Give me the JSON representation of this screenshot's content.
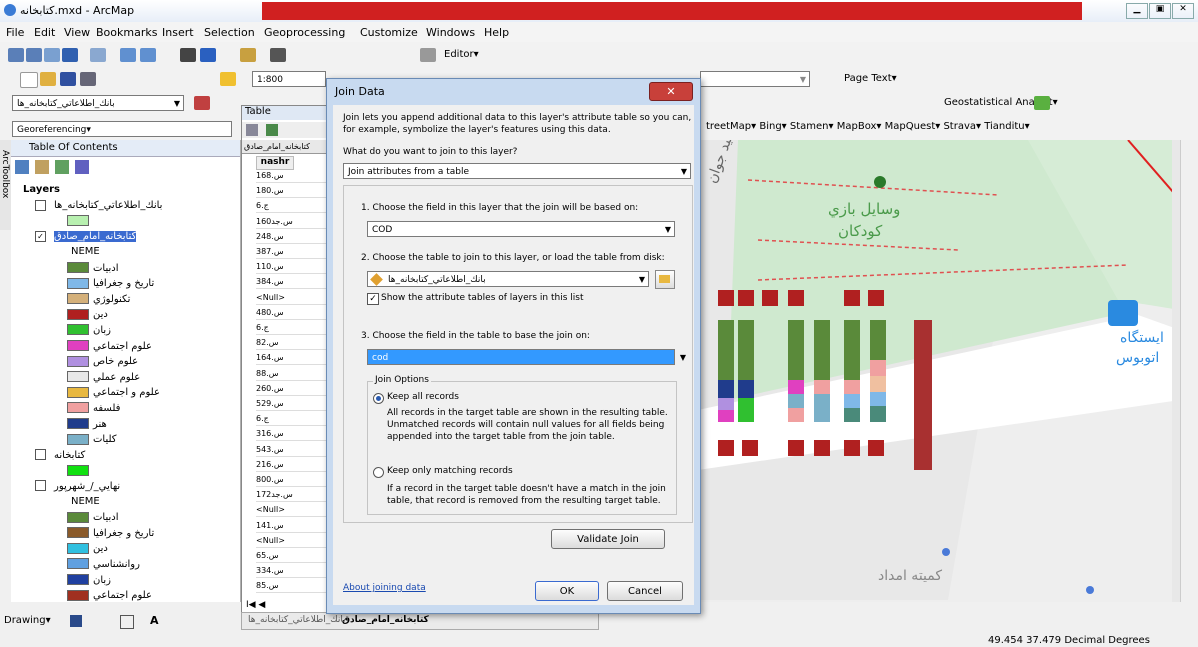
{
  "window": {
    "title": "کتابخانه.mxd - ArcMap"
  },
  "menu": [
    "File",
    "Edit",
    "View",
    "Bookmarks",
    "Insert",
    "Selection",
    "Geoprocessing",
    "Customize",
    "Windows",
    "Help"
  ],
  "toolbar": {
    "editor_label": "Editor▾",
    "scale_value": "1:800",
    "page_text": "Page Text▾",
    "layer_dropdown": "بانك_اطلاعاتي_كتابخانه_ها",
    "georeferencing": "Georeferencing▾",
    "geostatistical": "Geostatistical Analyst▾",
    "basemaps": [
      "treetMap▾",
      "Bing▾",
      "Stamen▾",
      "MapBox▾",
      "MapQuest▾",
      "Strava▾",
      "Tianditu▾"
    ],
    "drawing": "Drawing▾"
  },
  "toc": {
    "title": "Table Of Contents",
    "vertical_tab": "ArcToolbox",
    "rows": [
      {
        "label": "Layers",
        "kind": "group"
      },
      {
        "label": "بانك_اطلاعاتي_كتابخانه_ها",
        "kind": "layer"
      },
      {
        "label": "",
        "kind": "swatch",
        "color": "#b8f0b0"
      },
      {
        "label": "كتابخانه_امام_صادق",
        "kind": "layer-selected"
      },
      {
        "label": "NEME",
        "kind": "field"
      },
      {
        "label": "ادبيات",
        "kind": "swatch",
        "color": "#5a8a3a"
      },
      {
        "label": "تاريخ و جغرافيا",
        "kind": "swatch",
        "color": "#7fb8e8"
      },
      {
        "label": "تكنولوژي",
        "kind": "swatch",
        "color": "#d4b07a"
      },
      {
        "label": "دين",
        "kind": "swatch",
        "color": "#b02020"
      },
      {
        "label": "زبان",
        "kind": "swatch",
        "color": "#30c030"
      },
      {
        "label": "علوم اجتماعي",
        "kind": "swatch",
        "color": "#e040c0"
      },
      {
        "label": "علوم خاص",
        "kind": "swatch",
        "color": "#b090e0"
      },
      {
        "label": "علوم عملي",
        "kind": "swatch",
        "color": "#e8e8e8"
      },
      {
        "label": "علوم و اجتماعي",
        "kind": "swatch",
        "color": "#e8b840"
      },
      {
        "label": "فلسفه",
        "kind": "swatch",
        "color": "#f0a0a0"
      },
      {
        "label": "هنر",
        "kind": "swatch",
        "color": "#203c8c"
      },
      {
        "label": "كليات",
        "kind": "swatch",
        "color": "#7ab0c8"
      },
      {
        "label": "كتابخانه",
        "kind": "layer"
      },
      {
        "label": "",
        "kind": "swatch",
        "color": "#10e010"
      },
      {
        "label": "نهايي_/_شهرپور",
        "kind": "layer"
      },
      {
        "label": "NEME",
        "kind": "field"
      },
      {
        "label": "ادبيات",
        "kind": "swatch",
        "color": "#5a8a3a"
      },
      {
        "label": "تاريخ و جغرافيا",
        "kind": "swatch",
        "color": "#8a5a2a"
      },
      {
        "label": "دين",
        "kind": "swatch",
        "color": "#30c0e0"
      },
      {
        "label": "روانشناسي",
        "kind": "swatch",
        "color": "#60a0e0"
      },
      {
        "label": "زبان",
        "kind": "swatch",
        "color": "#2040a0"
      },
      {
        "label": "علوم اجتماعي",
        "kind": "swatch",
        "color": "#a03020"
      }
    ]
  },
  "table": {
    "title": "Table",
    "layer_tab": "كتابخانه_امام_صادق",
    "column": "nashr",
    "rows": [
      "168.س",
      "180.س",
      "6.ج",
      "160س.جد",
      "248.س",
      "387.س",
      "110.س",
      "384.س",
      "<Null>",
      "480.س",
      "6.ج",
      "82.س",
      "164.س",
      "88.س",
      "260.س",
      "529.س",
      "6.ج",
      "316.س",
      "543.س",
      "216.س",
      "800.س",
      "172س.جد",
      "<Null>",
      "141.س",
      "<Null>",
      "65.س",
      "334.س",
      "85.س"
    ],
    "nav": "I◀  ◀",
    "bottom_tabs": [
      "كتابخانه_امام_صادق",
      "بانك_اطلاعاتي_كتابخانه_ها"
    ]
  },
  "dialog": {
    "title": "Join Data",
    "intro": [
      "Join lets you append additional data to this layer's attribute table so you can,",
      "for example, symbolize the layer's features using this data."
    ],
    "question": "What do you want to join to this layer?",
    "join_type": "Join attributes from a table",
    "step1": "1.  Choose the field in this layer that the join will be based on:",
    "step1_value": "COD",
    "step2": "2.  Choose the table to join to this layer, or load the table from disk:",
    "step2_value": "بانك_اطلاعاتي_كتابخانه_ها",
    "show_checkbox": "Show the attribute tables of layers in this list",
    "step3": "3.  Choose the field in the table to base the join on:",
    "step3_value": "cod",
    "options_title": "Join Options",
    "keep_all": "Keep all records",
    "keep_all_desc": [
      "All records in the target table are shown in the resulting table.",
      "Unmatched records will contain null values for all fields being",
      "appended into the target table from the join table."
    ],
    "keep_matching": "Keep only matching records",
    "keep_matching_desc": [
      "If a record in the target table doesn't have a match in the join",
      "table, that record is removed from the resulting target table."
    ],
    "validate": "Validate Join",
    "about": "About joining data",
    "ok": "OK",
    "cancel": "Cancel"
  },
  "map": {
    "labels": [
      "وسايل بازي",
      "كودكان",
      "ايستگاه",
      "اتوبوس",
      "كميته امداد",
      "شهيد جوان"
    ]
  },
  "status": {
    "coords": "49.454  37.479 Decimal Degrees"
  }
}
